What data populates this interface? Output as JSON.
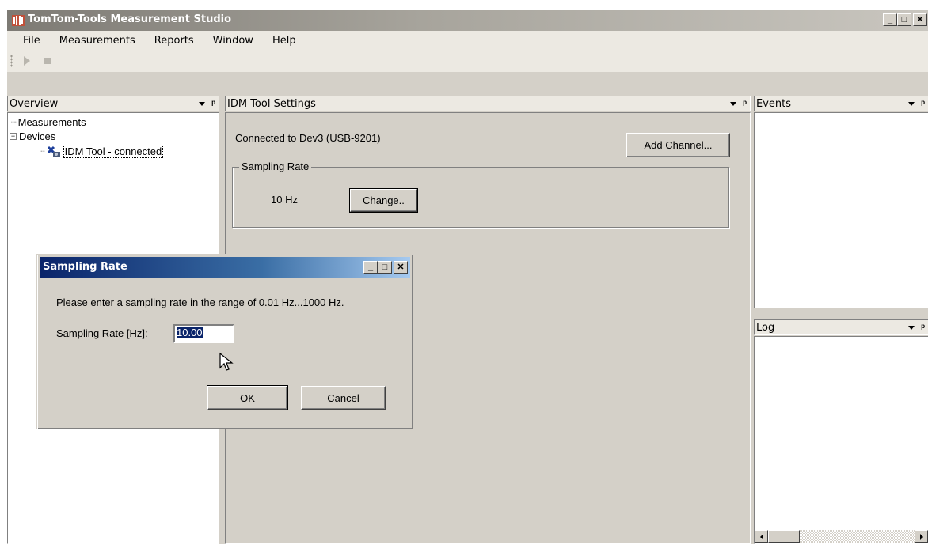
{
  "app": {
    "title": "TomTom-Tools Measurement Studio"
  },
  "window_controls": {
    "minimize": "_",
    "maximize": "□",
    "close": "✕"
  },
  "menu": [
    "File",
    "Measurements",
    "Reports",
    "Window",
    "Help"
  ],
  "toolbar": {
    "buttons": [
      "play-icon",
      "stop-icon"
    ]
  },
  "overview": {
    "title": "Overview",
    "tree": {
      "measurements": "Measurements",
      "devices": "Devices",
      "device": "IDM Tool - connected",
      "devices_expander": "−"
    }
  },
  "settings": {
    "title": "IDM Tool Settings",
    "connection": "Connected to Dev3 (USB-9201)",
    "add_channel": "Add Channel...",
    "group_label": "Sampling Rate",
    "rate_value": "10 Hz",
    "change": "Change.."
  },
  "events": {
    "title": "Events"
  },
  "log": {
    "title": "Log"
  },
  "dialog": {
    "title": "Sampling Rate",
    "message": "Please enter a sampling rate in the range of 0.01 Hz...1000 Hz.",
    "field_label": "Sampling Rate [Hz]:",
    "field_value": "10.00",
    "ok": "OK",
    "cancel": "Cancel"
  }
}
